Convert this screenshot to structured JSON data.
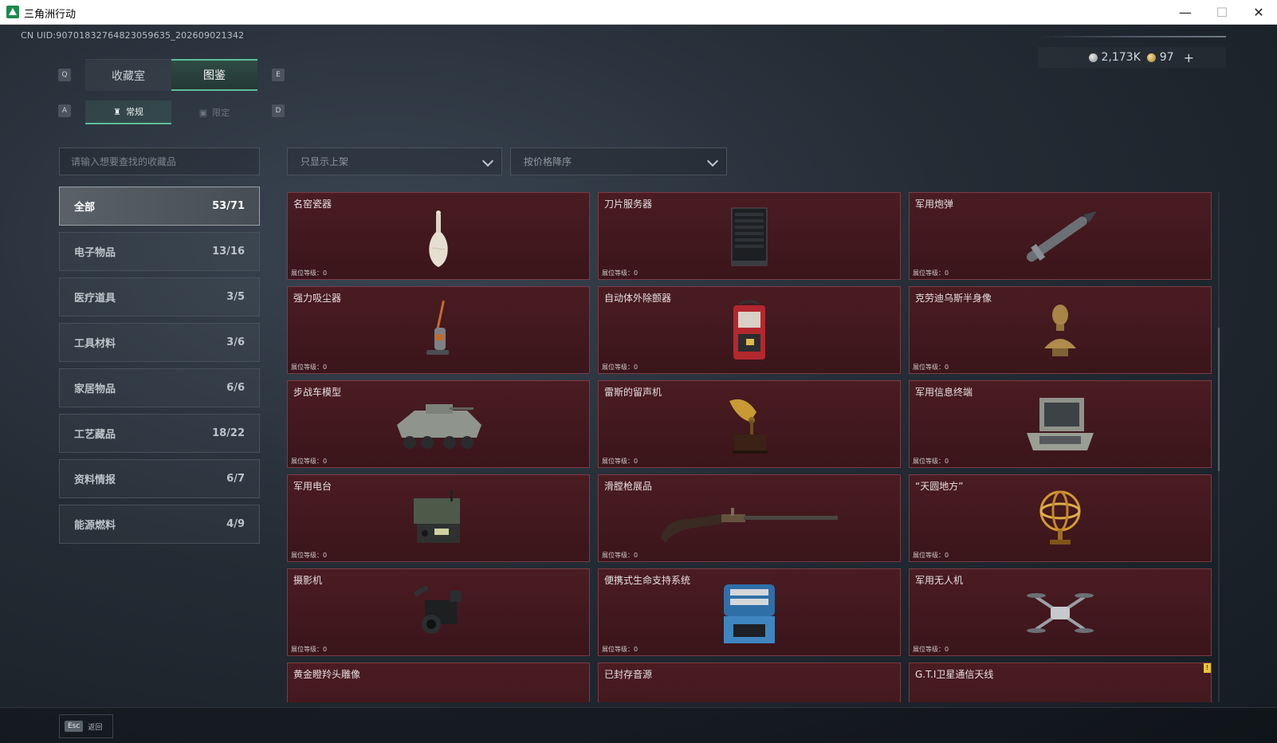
{
  "window": {
    "title": "三角洲行动",
    "min_symbol": "—",
    "max_symbol": "☐",
    "close_symbol": "✕"
  },
  "header": {
    "uid": "CN UID:9070183276482305963​5_202609021342",
    "currency_silver": "2,173K",
    "currency_gold": "97",
    "plus": "+"
  },
  "keys": {
    "q": "Q",
    "e": "E",
    "a": "A",
    "d": "D",
    "esc": "Esc"
  },
  "tabs": {
    "collection": "收藏室",
    "catalog": "图鉴",
    "regular": "常规",
    "limited": "限定"
  },
  "filters": {
    "search_placeholder": "请输入想要查找的收藏品",
    "shelf_filter": "只显示上架",
    "sort": "按价格降序"
  },
  "categories": [
    {
      "label": "全部",
      "count": "53/71"
    },
    {
      "label": "电子物品",
      "count": "13/16"
    },
    {
      "label": "医疗道具",
      "count": "3/5"
    },
    {
      "label": "工具材料",
      "count": "3/6"
    },
    {
      "label": "家居物品",
      "count": "6/6"
    },
    {
      "label": "工艺藏品",
      "count": "18/22"
    },
    {
      "label": "资料情报",
      "count": "6/7"
    },
    {
      "label": "能源燃料",
      "count": "4/9"
    }
  ],
  "level_label": "展位等级：0",
  "items": [
    {
      "name": "名窑瓷器",
      "icon": "porcelain-vase-icon"
    },
    {
      "name": "刀片服务器",
      "icon": "blade-server-icon"
    },
    {
      "name": "军用炮弹",
      "icon": "artillery-shell-icon"
    },
    {
      "name": "强力吸尘器",
      "icon": "vacuum-cleaner-icon"
    },
    {
      "name": "自动体外除颤器",
      "icon": "defibrillator-icon"
    },
    {
      "name": "克劳迪乌斯半身像",
      "icon": "bust-statue-icon"
    },
    {
      "name": "步战车模型",
      "icon": "armored-vehicle-icon"
    },
    {
      "name": "雷斯的留声机",
      "icon": "gramophone-icon"
    },
    {
      "name": "军用信息终端",
      "icon": "military-terminal-icon"
    },
    {
      "name": "军用电台",
      "icon": "military-radio-icon"
    },
    {
      "name": "滑膛枪展品",
      "icon": "musket-icon"
    },
    {
      "name": "“天圆地方”",
      "icon": "armillary-sphere-icon"
    },
    {
      "name": "摄影机",
      "icon": "camera-icon"
    },
    {
      "name": "便携式生命支持系统",
      "icon": "life-support-icon"
    },
    {
      "name": "军用无人机",
      "icon": "drone-icon"
    },
    {
      "name": "黄金瞪羚头雕像",
      "icon": "statue-icon"
    },
    {
      "name": "已封存音源",
      "icon": "audio-icon"
    },
    {
      "name": "G.T.I卫星通信天线",
      "icon": "antenna-icon"
    }
  ],
  "bottom": {
    "back": "返回"
  }
}
